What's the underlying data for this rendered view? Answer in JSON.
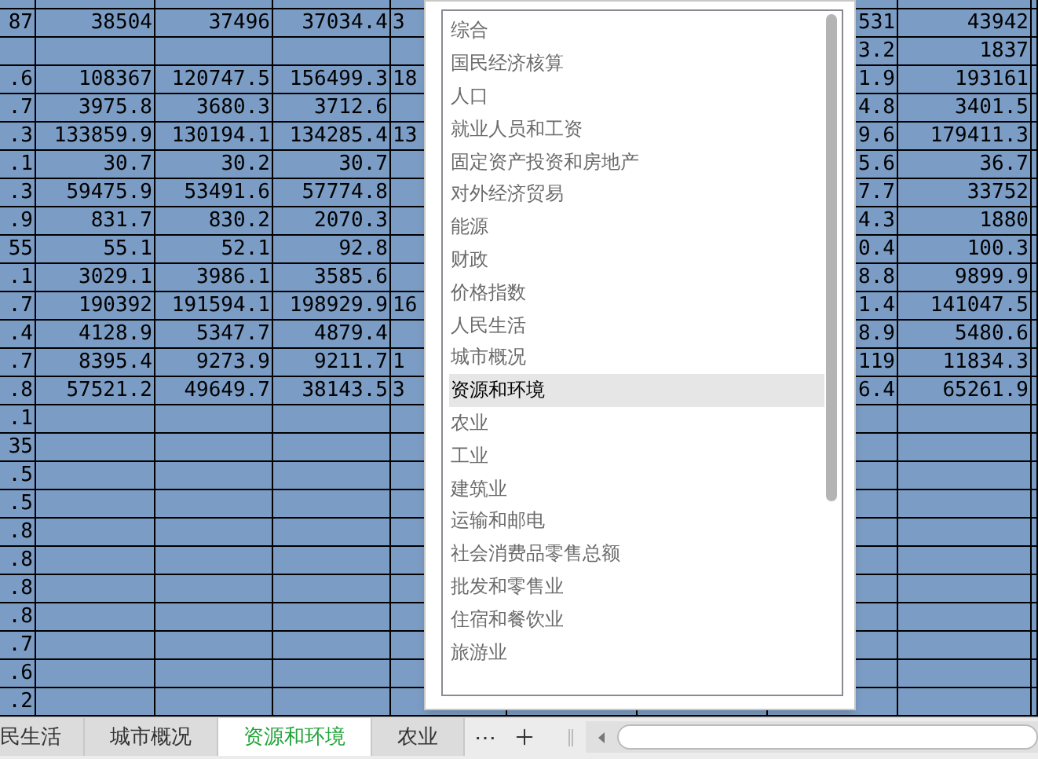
{
  "sheet": {
    "rows": [
      [
        "87",
        "38504",
        "37496",
        "37034.4",
        "3",
        "531",
        "43942"
      ],
      [
        null,
        null,
        null,
        null,
        null,
        "3.2",
        "1837"
      ],
      [
        ".6",
        "108367",
        "120747.5",
        "156499.3",
        "18",
        "1.9",
        "193161"
      ],
      [
        ".7",
        "3975.8",
        "3680.3",
        "3712.6",
        null,
        "4.8",
        "3401.5"
      ],
      [
        ".3",
        "133859.9",
        "130194.1",
        "134285.4",
        "13",
        "9.6",
        "179411.3"
      ],
      [
        ".1",
        "30.7",
        "30.2",
        "30.7",
        null,
        "5.6",
        "36.7"
      ],
      [
        ".3",
        "59475.9",
        "53491.6",
        "57774.8",
        null,
        "7.7",
        "33752"
      ],
      [
        ".9",
        "831.7",
        "830.2",
        "2070.3",
        null,
        "4.3",
        "1880"
      ],
      [
        "55",
        "55.1",
        "52.1",
        "92.8",
        null,
        "0.4",
        "100.3"
      ],
      [
        ".1",
        "3029.1",
        "3986.1",
        "3585.6",
        null,
        "8.8",
        "9899.9"
      ],
      [
        ".7",
        "190392",
        "191594.1",
        "198929.9",
        "16",
        "1.4",
        "141047.5"
      ],
      [
        ".4",
        "4128.9",
        "5347.7",
        "4879.4",
        null,
        "8.9",
        "5480.6"
      ],
      [
        ".7",
        "8395.4",
        "9273.9",
        "9211.7",
        "1",
        "119",
        "11834.3"
      ],
      [
        ".8",
        "57521.2",
        "49649.7",
        "38143.5",
        "3",
        "6.4",
        "65261.9"
      ],
      [
        ".1",
        null,
        null,
        null,
        null,
        null,
        null
      ],
      [
        "35",
        null,
        null,
        null,
        null,
        null,
        null
      ],
      [
        ".5",
        null,
        null,
        null,
        null,
        null,
        null
      ],
      [
        ".5",
        null,
        null,
        null,
        null,
        null,
        null
      ],
      [
        ".8",
        null,
        null,
        null,
        null,
        null,
        null
      ],
      [
        ".8",
        null,
        null,
        null,
        null,
        null,
        null
      ],
      [
        ".8",
        null,
        null,
        null,
        null,
        null,
        null
      ],
      [
        ".8",
        null,
        null,
        null,
        null,
        null,
        null
      ],
      [
        ".7",
        null,
        null,
        null,
        null,
        null,
        null
      ],
      [
        ".6",
        null,
        null,
        null,
        null,
        null,
        null
      ],
      [
        ".2",
        null,
        null,
        null,
        null,
        null,
        null
      ]
    ]
  },
  "dropdown": {
    "items": [
      {
        "label": "综合",
        "selected": false
      },
      {
        "label": "国民经济核算",
        "selected": false
      },
      {
        "label": "人口",
        "selected": false
      },
      {
        "label": "就业人员和工资",
        "selected": false
      },
      {
        "label": "固定资产投资和房地产",
        "selected": false
      },
      {
        "label": "对外经济贸易",
        "selected": false
      },
      {
        "label": "能源",
        "selected": false
      },
      {
        "label": "财政",
        "selected": false
      },
      {
        "label": "价格指数",
        "selected": false
      },
      {
        "label": "人民生活",
        "selected": false
      },
      {
        "label": "城市概况",
        "selected": false
      },
      {
        "label": "资源和环境",
        "selected": true
      },
      {
        "label": "农业",
        "selected": false
      },
      {
        "label": "工业",
        "selected": false
      },
      {
        "label": "建筑业",
        "selected": false
      },
      {
        "label": "运输和邮电",
        "selected": false
      },
      {
        "label": "社会消费品零售总额",
        "selected": false
      },
      {
        "label": "批发和零售业",
        "selected": false
      },
      {
        "label": "住宿和餐饮业",
        "selected": false
      },
      {
        "label": "旅游业",
        "selected": false
      }
    ]
  },
  "sheet_tabs": [
    {
      "label": "民生活",
      "selected": false
    },
    {
      "label": "城市概况",
      "selected": false
    },
    {
      "label": "资源和环境",
      "selected": true
    },
    {
      "label": "农业",
      "selected": false
    }
  ],
  "more_tabs": "⋯"
}
